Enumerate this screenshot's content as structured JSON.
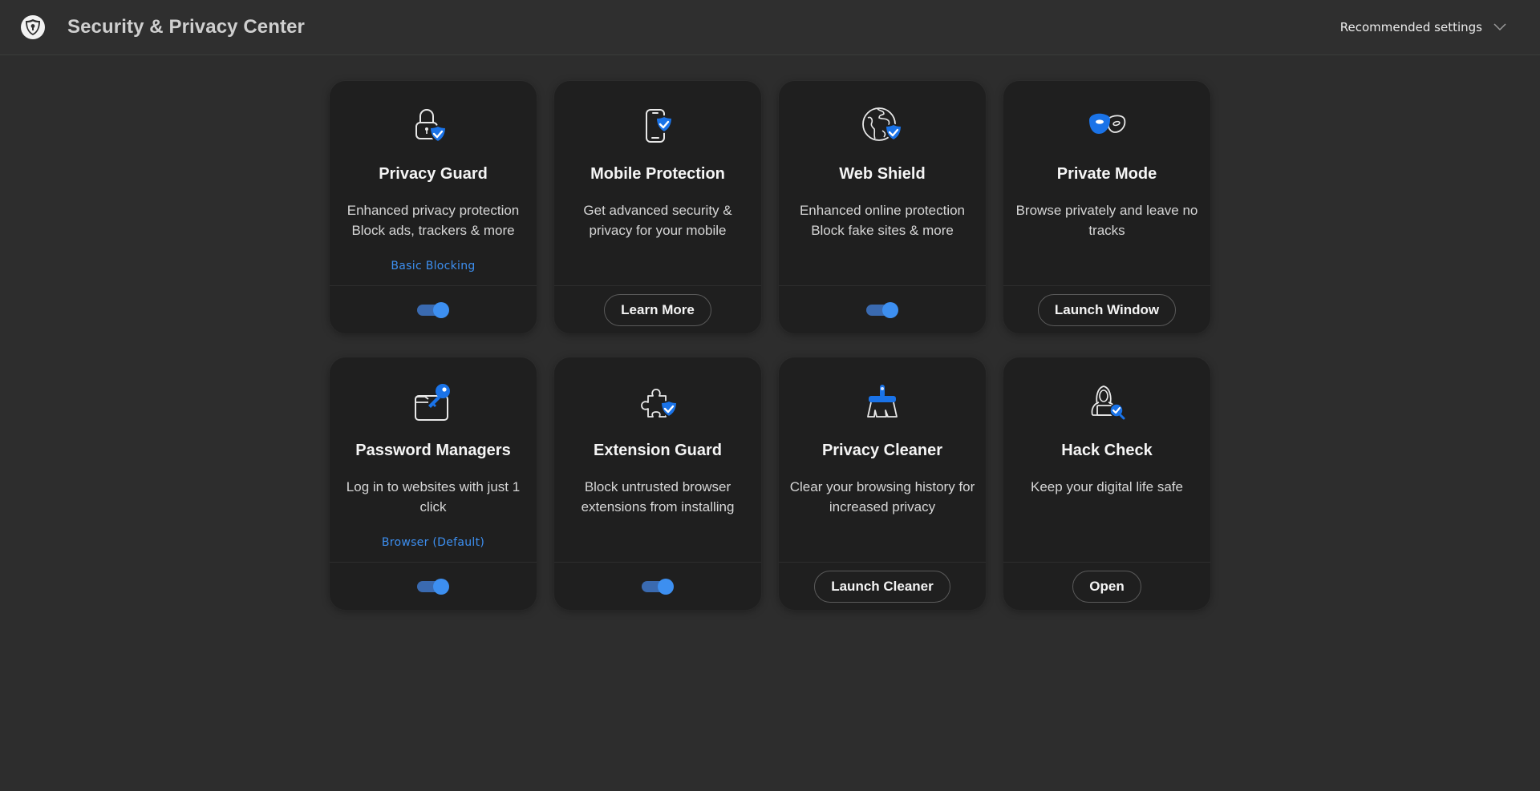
{
  "header": {
    "title": "Security & Privacy Center",
    "logo_icon": "shield-lock-logo-icon",
    "settings_dropdown": {
      "label": "Recommended settings",
      "icon": "chevron-down-icon"
    }
  },
  "colors": {
    "accent": "#3d8ff0",
    "icon_blue": "#1a73e8",
    "background": "#2d2d2d",
    "card": "#1f1f1f"
  },
  "cards": [
    {
      "title": "Privacy Guard",
      "icon": "lock-shield-icon",
      "description": "Enhanced privacy protection Block ads, trackers & more",
      "link": "Basic Blocking",
      "control": "toggle",
      "toggle_on": true
    },
    {
      "title": "Mobile Protection",
      "icon": "phone-shield-icon",
      "description": "Get advanced security & privacy for your mobile",
      "control": "button",
      "button_label": "Learn More"
    },
    {
      "title": "Web Shield",
      "icon": "globe-shield-icon",
      "description": "Enhanced online protection Block fake sites & more",
      "control": "toggle",
      "toggle_on": true
    },
    {
      "title": "Private Mode",
      "icon": "masks-icon",
      "description": "Browse privately and leave no tracks",
      "control": "button",
      "button_label": "Launch Window"
    },
    {
      "title": "Password Managers",
      "icon": "key-wallet-icon",
      "description": "Log in to websites with just 1 click",
      "link": "Browser (Default)",
      "control": "toggle",
      "toggle_on": true
    },
    {
      "title": "Extension Guard",
      "icon": "puzzle-shield-icon",
      "description": "Block untrusted browser extensions from installing",
      "control": "toggle",
      "toggle_on": true
    },
    {
      "title": "Privacy Cleaner",
      "icon": "broom-icon",
      "description": "Clear your browsing history for increased privacy",
      "control": "button",
      "button_label": "Launch Cleaner"
    },
    {
      "title": "Hack Check",
      "icon": "hacker-search-icon",
      "description": "Keep your digital life safe",
      "control": "button",
      "button_label": "Open"
    }
  ]
}
